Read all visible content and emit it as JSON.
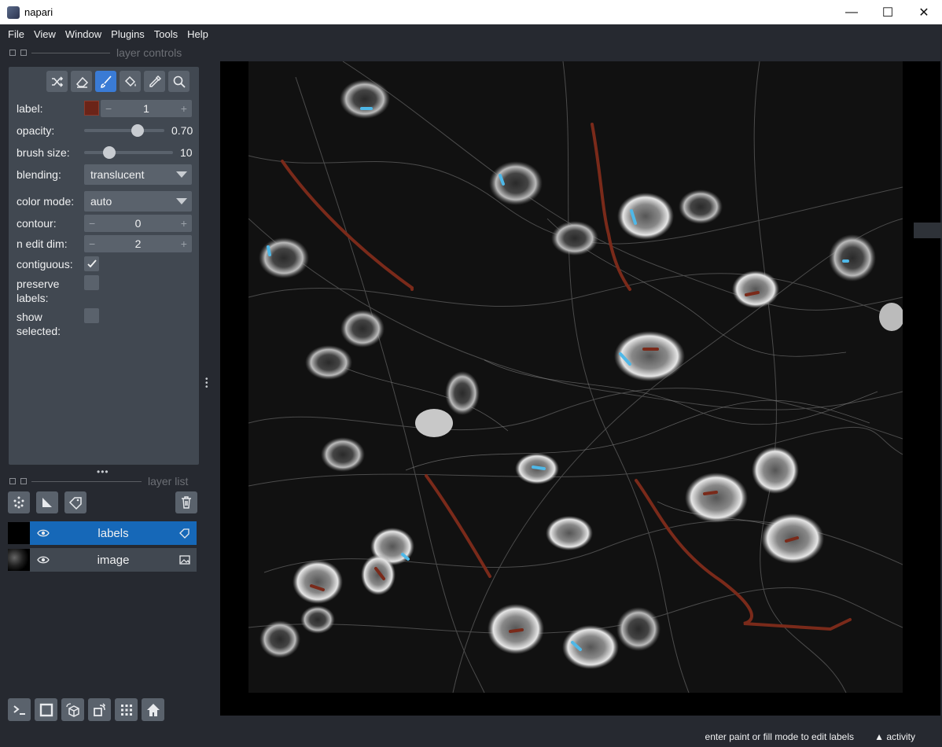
{
  "window": {
    "title": "napari",
    "min_glyph": "—",
    "max_glyph": "☐",
    "close_glyph": "✕"
  },
  "menu": [
    "File",
    "View",
    "Window",
    "Plugins",
    "Tools",
    "Help"
  ],
  "layer_controls": {
    "header": "layer controls",
    "tools": [
      "shuffle-icon",
      "eraser-icon",
      "paint-brush-icon",
      "fill-bucket-icon",
      "color-picker-icon",
      "zoom-icon"
    ],
    "active_tool": "paint-brush-icon",
    "label_text": "label:",
    "label_value": "1",
    "label_color": "#6b2418",
    "opacity_text": "opacity:",
    "opacity_value": "0.70",
    "opacity_level": 0.7,
    "brush_size_text": "brush size:",
    "brush_size_value": "10",
    "blending_text": "blending:",
    "blending_value": "translucent",
    "color_mode_text": "color mode:",
    "color_mode_value": "auto",
    "contour_text": "contour:",
    "contour_value": "0",
    "n_edit_dim_text": "n edit dim:",
    "n_edit_dim_value": "2",
    "contiguous_text": "contiguous:",
    "contiguous_checked": true,
    "preserve_labels_line1": "preserve",
    "preserve_labels_line2": "labels:",
    "show_selected_line1": "show",
    "show_selected_line2": "selected:",
    "minus": "−",
    "plus": "+"
  },
  "layer_list": {
    "header": "layer list",
    "layers": [
      {
        "name": "labels",
        "selected": true,
        "kind_icon": "label-tag-icon"
      },
      {
        "name": "image",
        "selected": false,
        "kind_icon": "image-icon"
      }
    ]
  },
  "status": {
    "message": "enter paint or fill mode to edit labels",
    "activity": "activity"
  },
  "colors": {
    "background": "#262930",
    "panel": "#414851",
    "button": "#5a626c",
    "accent": "#3a7bd5",
    "label_red": "#7a2a1a",
    "label_blue": "#4fb8e8"
  }
}
